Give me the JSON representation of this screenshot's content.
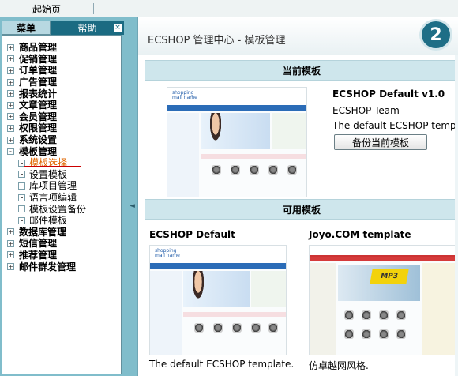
{
  "topbar": {
    "start_label": "起始页"
  },
  "left_tabs": {
    "menu": "菜单",
    "help": "帮助",
    "close": "×"
  },
  "menu": {
    "items_before": [
      {
        "label": "商品管理",
        "toggle": "+"
      },
      {
        "label": "促销管理",
        "toggle": "+"
      },
      {
        "label": "订单管理",
        "toggle": "+"
      },
      {
        "label": "广告管理",
        "toggle": "+"
      },
      {
        "label": "报表统计",
        "toggle": "+"
      },
      {
        "label": "文章管理",
        "toggle": "+"
      },
      {
        "label": "会员管理",
        "toggle": "+"
      },
      {
        "label": "权限管理",
        "toggle": "+"
      },
      {
        "label": "系统设置",
        "toggle": "+"
      },
      {
        "label": "模板管理",
        "toggle": "-"
      }
    ],
    "sub_items": [
      {
        "label": "模板选择",
        "active": true
      },
      {
        "label": "设置模板",
        "active": false
      },
      {
        "label": "库项目管理",
        "active": false
      },
      {
        "label": "语言项编辑",
        "active": false
      },
      {
        "label": "模板设置备份",
        "active": false
      },
      {
        "label": "邮件模板",
        "active": false
      }
    ],
    "items_after": [
      {
        "label": "数据库管理",
        "toggle": "+"
      },
      {
        "label": "短信管理",
        "toggle": "+"
      },
      {
        "label": "推荐管理",
        "toggle": "+"
      },
      {
        "label": "邮件群发管理",
        "toggle": "+"
      }
    ]
  },
  "splitter": {
    "arrow": "◄"
  },
  "header": {
    "title": "ECSHOP 管理中心  - 模板管理",
    "badge": "2"
  },
  "current": {
    "heading": "当前模板",
    "name": "ECSHOP Default v1.0",
    "author": "ECSHOP Team",
    "desc": "The default ECSHOP template.",
    "backup_button": "备份当前模板",
    "thumb_logo": "shopping mall name"
  },
  "available": {
    "heading": "可用模板",
    "templates": [
      {
        "name": "ECSHOP Default",
        "desc": "The default ECSHOP template.",
        "thumb_logo": "shopping mall name"
      },
      {
        "name": "Joyo.COM template",
        "desc": "仿卓越网风格.",
        "thumb_banner": "MP3"
      }
    ]
  },
  "colors": {
    "sidebar_bg": "#80BDCB",
    "tab_active": "#1B6B82",
    "section_bg": "#CEE6EC",
    "active_link": "#E06600",
    "badge_bg": "#1E6E86"
  }
}
